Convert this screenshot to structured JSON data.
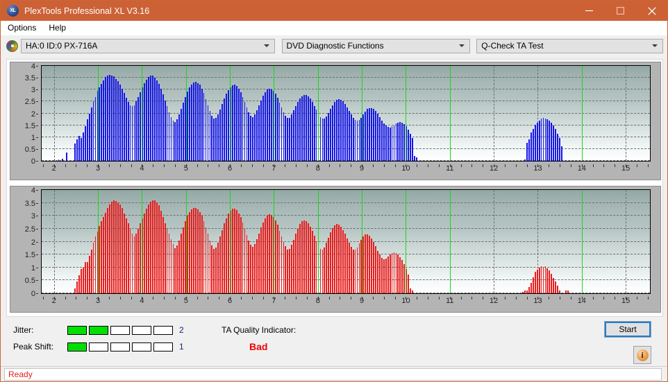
{
  "window": {
    "title": "PlexTools Professional XL V3.16",
    "app_icon": "XL",
    "minimize_label": "Minimize",
    "maximize_label": "Maximize",
    "close_label": "Close"
  },
  "menu": {
    "items": [
      {
        "label": "Options"
      },
      {
        "label": "Help"
      }
    ]
  },
  "toolbar": {
    "drive_combo": "HA:0 ID:0  PX-716A",
    "function_combo": "DVD Diagnostic Functions",
    "test_combo": "Q-Check TA Test"
  },
  "bottom": {
    "jitter_label": "Jitter:",
    "jitter_value": "2",
    "jitter_filled": 2,
    "jitter_segments": 5,
    "peak_shift_label": "Peak Shift:",
    "peak_shift_value": "1",
    "peak_shift_filled": 1,
    "peak_shift_segments": 5,
    "ta_quality_label": "TA Quality Indicator:",
    "ta_quality_value": "Bad",
    "ta_quality_color": "#ee0000",
    "start_label": "Start",
    "info_label": "i"
  },
  "status": {
    "text": "Ready",
    "color": "#e02020"
  },
  "colors": {
    "titlebar": "#cc6136",
    "blue_bars": "#1515e8",
    "red_bars": "#ec1a1a",
    "marker_line": "#16d916",
    "meter_on": "#00e000"
  },
  "chart_data": [
    {
      "type": "bar",
      "title": "",
      "xlabel": "",
      "ylabel": "",
      "series_color": "#1515e8",
      "xlim": [
        1.72,
        15.55
      ],
      "ylim": [
        0,
        4
      ],
      "yticks": [
        0,
        0.5,
        1,
        1.5,
        2,
        2.5,
        3,
        3.5,
        4
      ],
      "xticks": [
        2,
        3,
        4,
        5,
        6,
        7,
        8,
        9,
        10,
        11,
        12,
        13,
        14,
        15
      ],
      "grid": true,
      "markers": [
        3,
        4,
        5,
        6,
        7,
        8,
        9,
        10,
        11,
        14
      ],
      "x_start": 1.72,
      "x_step": 0.0465,
      "values": [
        0,
        0,
        0,
        0,
        0,
        0,
        0,
        0,
        0.06,
        0,
        0.1,
        0,
        0.34,
        0,
        0,
        0,
        0.72,
        0.9,
        1.05,
        0.95,
        1.2,
        1.45,
        1.75,
        2.0,
        2.25,
        2.5,
        2.7,
        2.95,
        3.1,
        3.25,
        3.4,
        3.52,
        3.6,
        3.62,
        3.6,
        3.55,
        3.45,
        3.35,
        3.2,
        3.05,
        2.85,
        2.65,
        2.48,
        2.35,
        2.3,
        2.35,
        2.5,
        2.7,
        2.9,
        3.1,
        3.28,
        3.42,
        3.52,
        3.58,
        3.58,
        3.5,
        3.4,
        3.25,
        3.05,
        2.8,
        2.55,
        2.3,
        2.05,
        1.85,
        1.7,
        1.65,
        1.75,
        1.95,
        2.2,
        2.45,
        2.7,
        2.92,
        3.1,
        3.22,
        3.3,
        3.32,
        3.28,
        3.2,
        3.05,
        2.85,
        2.6,
        2.35,
        2.1,
        1.9,
        1.78,
        1.8,
        1.95,
        2.15,
        2.4,
        2.62,
        2.82,
        2.98,
        3.1,
        3.18,
        3.2,
        3.15,
        3.05,
        2.9,
        2.7,
        2.48,
        2.25,
        2.05,
        1.9,
        1.85,
        1.95,
        2.12,
        2.35,
        2.55,
        2.75,
        2.9,
        3.0,
        3.05,
        3.02,
        2.95,
        2.82,
        2.65,
        2.45,
        2.25,
        2.05,
        1.9,
        1.8,
        1.82,
        1.95,
        2.12,
        2.3,
        2.48,
        2.62,
        2.72,
        2.78,
        2.78,
        2.72,
        2.62,
        2.48,
        2.32,
        2.15,
        1.98,
        1.85,
        1.78,
        1.78,
        1.88,
        2.02,
        2.18,
        2.35,
        2.48,
        2.56,
        2.6,
        2.58,
        2.5,
        2.4,
        2.25,
        2.1,
        1.95,
        1.82,
        1.72,
        1.68,
        1.72,
        1.82,
        1.95,
        2.08,
        2.18,
        2.22,
        2.22,
        2.18,
        2.1,
        1.98,
        1.85,
        1.7,
        1.58,
        1.48,
        1.42,
        1.4,
        1.45,
        1.5,
        1.58,
        1.62,
        1.64,
        1.62,
        1.55,
        1.45,
        1.3,
        1.15,
        0.95,
        0.2,
        0.15,
        0,
        0,
        0,
        0,
        0,
        0,
        0,
        0,
        0,
        0,
        0,
        0,
        0,
        0,
        0,
        0,
        0,
        0,
        0,
        0,
        0,
        0,
        0,
        0,
        0,
        0,
        0,
        0,
        0,
        0,
        0,
        0,
        0,
        0,
        0,
        0,
        0,
        0,
        0,
        0,
        0,
        0,
        0,
        0,
        0,
        0,
        0,
        0,
        0,
        0,
        0,
        0,
        0.05,
        0.75,
        0.9,
        1.2,
        1.35,
        1.52,
        1.62,
        1.7,
        1.78,
        1.8,
        1.78,
        1.74,
        1.68,
        1.6,
        1.5,
        1.35,
        1.15,
        0.95,
        0.6,
        0,
        0,
        0,
        0,
        0,
        0,
        0,
        0,
        0,
        0,
        0,
        0,
        0,
        0,
        0,
        0,
        0,
        0,
        0,
        0
      ]
    },
    {
      "type": "bar",
      "title": "",
      "xlabel": "",
      "ylabel": "",
      "series_color": "#ec1a1a",
      "xlim": [
        1.72,
        15.55
      ],
      "ylim": [
        0,
        4
      ],
      "yticks": [
        0,
        0.5,
        1,
        1.5,
        2,
        2.5,
        3,
        3.5,
        4
      ],
      "xticks": [
        2,
        3,
        4,
        5,
        6,
        7,
        8,
        9,
        10,
        11,
        12,
        13,
        14,
        15
      ],
      "grid": true,
      "markers": [
        3,
        4,
        5,
        6,
        7,
        8,
        9,
        10,
        11,
        14
      ],
      "x_start": 1.72,
      "x_step": 0.0465,
      "values": [
        0,
        0,
        0,
        0,
        0,
        0,
        0,
        0,
        0,
        0,
        0,
        0,
        0,
        0,
        0,
        0,
        0.2,
        0.45,
        0.7,
        0.95,
        1.0,
        1.2,
        1.22,
        1.45,
        1.7,
        1.95,
        2.2,
        2.4,
        2.6,
        2.8,
        2.95,
        3.12,
        3.3,
        3.45,
        3.55,
        3.6,
        3.58,
        3.52,
        3.45,
        3.3,
        3.1,
        2.9,
        2.7,
        2.5,
        2.3,
        2.2,
        2.3,
        2.5,
        2.7,
        2.9,
        3.1,
        3.28,
        3.45,
        3.55,
        3.6,
        3.6,
        3.52,
        3.4,
        3.2,
        2.95,
        2.72,
        2.5,
        2.3,
        2.1,
        1.9,
        1.75,
        1.85,
        2.05,
        2.3,
        2.55,
        2.8,
        3.0,
        3.15,
        3.25,
        3.3,
        3.3,
        3.25,
        3.15,
        3.0,
        2.8,
        2.55,
        2.3,
        2.05,
        1.85,
        1.72,
        1.78,
        1.95,
        2.2,
        2.45,
        2.7,
        2.9,
        3.08,
        3.2,
        3.28,
        3.28,
        3.22,
        3.1,
        2.95,
        2.75,
        2.5,
        2.25,
        2.05,
        1.88,
        1.8,
        1.9,
        2.1,
        2.32,
        2.55,
        2.75,
        2.9,
        3.0,
        3.05,
        3.02,
        2.95,
        2.82,
        2.65,
        2.42,
        2.2,
        2.0,
        1.82,
        1.7,
        1.72,
        1.88,
        2.08,
        2.3,
        2.5,
        2.68,
        2.78,
        2.82,
        2.8,
        2.72,
        2.58,
        2.42,
        2.22,
        2.02,
        1.85,
        1.72,
        1.68,
        1.78,
        1.95,
        2.15,
        2.35,
        2.52,
        2.62,
        2.68,
        2.66,
        2.58,
        2.45,
        2.3,
        2.12,
        1.95,
        1.8,
        1.7,
        1.68,
        1.78,
        1.92,
        2.08,
        2.2,
        2.28,
        2.28,
        2.22,
        2.12,
        1.98,
        1.82,
        1.65,
        1.5,
        1.38,
        1.32,
        1.35,
        1.42,
        1.5,
        1.55,
        1.58,
        1.56,
        1.5,
        1.4,
        1.28,
        1.12,
        0.95,
        0.72,
        0.2,
        0.1,
        0,
        0,
        0,
        0,
        0,
        0,
        0,
        0,
        0,
        0,
        0,
        0,
        0,
        0,
        0,
        0,
        0,
        0,
        0,
        0,
        0,
        0,
        0,
        0,
        0,
        0,
        0,
        0,
        0,
        0,
        0,
        0,
        0,
        0,
        0,
        0,
        0,
        0,
        0,
        0,
        0,
        0,
        0,
        0,
        0,
        0,
        0,
        0,
        0,
        0,
        0,
        0,
        0,
        0.05,
        0.1,
        0.12,
        0.25,
        0.4,
        0.62,
        0.82,
        0.92,
        1.0,
        1.05,
        1.02,
        1.05,
        0.98,
        0.88,
        0.75,
        0.6,
        0.45,
        0.3,
        0.12,
        0,
        0,
        0.12,
        0.1,
        0,
        0,
        0,
        0,
        0,
        0,
        0,
        0,
        0,
        0,
        0,
        0,
        0,
        0,
        0,
        0
      ]
    }
  ]
}
